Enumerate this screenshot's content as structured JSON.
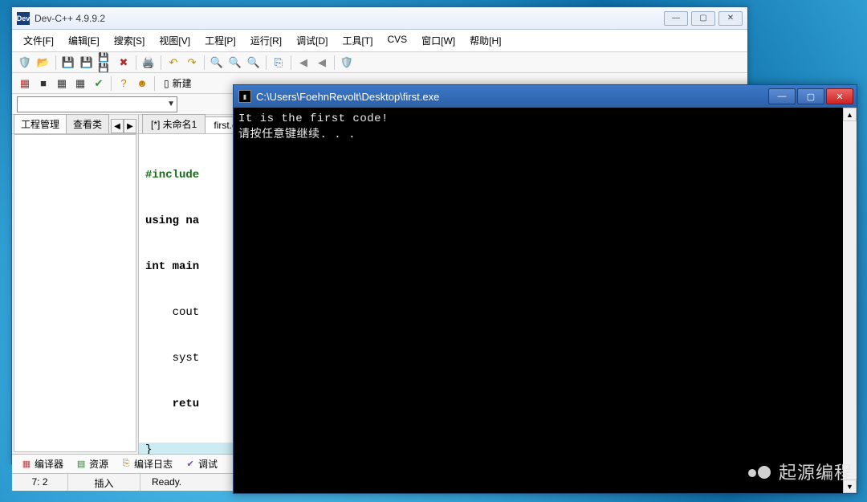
{
  "devc": {
    "title": "Dev-C++ 4.9.9.2",
    "menu": [
      "文件[F]",
      "编辑[E]",
      "搜索[S]",
      "视图[V]",
      "工程[P]",
      "运行[R]",
      "调试[D]",
      "工具[T]",
      "CVS",
      "窗口[W]",
      "帮助[H]"
    ],
    "toolbar2": {
      "new_label": "新建"
    },
    "left_tabs": {
      "project": "工程管理",
      "classes": "查看类"
    },
    "editor_tabs": {
      "unnamed": "[*] 未命名1",
      "first": "first.cpp"
    },
    "code_lines": [
      "#include",
      "using na",
      "int main",
      "    cout",
      "    syst",
      "    retu",
      "}"
    ],
    "bottom_tabs": {
      "compiler": "编译器",
      "resources": "资源",
      "compile_log": "编译日志",
      "debug": "调试"
    },
    "status": {
      "pos": "7: 2",
      "mode": "插入",
      "ready": "Ready."
    }
  },
  "console": {
    "title": "C:\\Users\\FoehnRevolt\\Desktop\\first.exe",
    "line1": "It is the first code!",
    "line2": "请按任意键继续. . ."
  },
  "watermark": {
    "text": "起源编程"
  }
}
